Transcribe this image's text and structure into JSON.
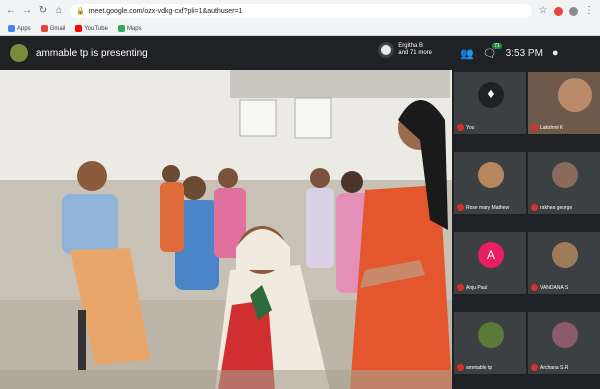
{
  "browser": {
    "url": "meet.google.com/ozx-vdkg-cxf?pli=1&authuser=1",
    "bookmarks": [
      "Apps",
      "Gmail",
      "YouTube",
      "Maps"
    ]
  },
  "meet": {
    "presenting_text": "ammable tp is presenting",
    "pinned_user": {
      "name": "Ergitha B",
      "more": "and 71 more"
    },
    "clock": "3:53 PM",
    "people_count": "71",
    "participants": [
      {
        "name": "You",
        "kind": "logo",
        "color": "#ffffff"
      },
      {
        "name": "Lakshmi K",
        "kind": "video",
        "color": "#b98b6b"
      },
      {
        "name": "Rose mary Mathew",
        "kind": "photo",
        "color": "#b7865c"
      },
      {
        "name": "rakhea george",
        "kind": "photo",
        "color": "#8a6a5a"
      },
      {
        "name": "Anju Paul",
        "kind": "letter",
        "letter": "A",
        "color": "#e91e63"
      },
      {
        "name": "VANDANA S",
        "kind": "photo",
        "color": "#9e7c5a"
      },
      {
        "name": "ammable tp",
        "kind": "photo",
        "color": "#5b7a3a"
      },
      {
        "name": "Archana S.R",
        "kind": "photo",
        "color": "#8b5b6b"
      }
    ]
  }
}
